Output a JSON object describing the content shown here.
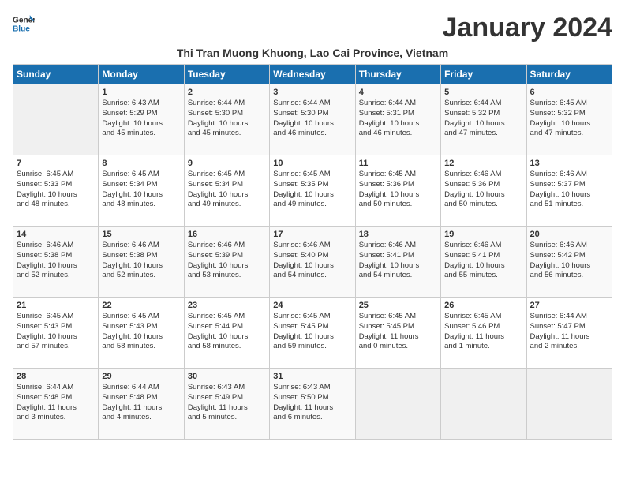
{
  "header": {
    "logo_general": "General",
    "logo_blue": "Blue",
    "month_year": "January 2024",
    "location": "Thi Tran Muong Khuong, Lao Cai Province, Vietnam"
  },
  "days_of_week": [
    "Sunday",
    "Monday",
    "Tuesday",
    "Wednesday",
    "Thursday",
    "Friday",
    "Saturday"
  ],
  "weeks": [
    [
      {
        "day": "",
        "info": ""
      },
      {
        "day": "1",
        "info": "Sunrise: 6:43 AM\nSunset: 5:29 PM\nDaylight: 10 hours\nand 45 minutes."
      },
      {
        "day": "2",
        "info": "Sunrise: 6:44 AM\nSunset: 5:30 PM\nDaylight: 10 hours\nand 45 minutes."
      },
      {
        "day": "3",
        "info": "Sunrise: 6:44 AM\nSunset: 5:30 PM\nDaylight: 10 hours\nand 46 minutes."
      },
      {
        "day": "4",
        "info": "Sunrise: 6:44 AM\nSunset: 5:31 PM\nDaylight: 10 hours\nand 46 minutes."
      },
      {
        "day": "5",
        "info": "Sunrise: 6:44 AM\nSunset: 5:32 PM\nDaylight: 10 hours\nand 47 minutes."
      },
      {
        "day": "6",
        "info": "Sunrise: 6:45 AM\nSunset: 5:32 PM\nDaylight: 10 hours\nand 47 minutes."
      }
    ],
    [
      {
        "day": "7",
        "info": "Sunrise: 6:45 AM\nSunset: 5:33 PM\nDaylight: 10 hours\nand 48 minutes."
      },
      {
        "day": "8",
        "info": "Sunrise: 6:45 AM\nSunset: 5:34 PM\nDaylight: 10 hours\nand 48 minutes."
      },
      {
        "day": "9",
        "info": "Sunrise: 6:45 AM\nSunset: 5:34 PM\nDaylight: 10 hours\nand 49 minutes."
      },
      {
        "day": "10",
        "info": "Sunrise: 6:45 AM\nSunset: 5:35 PM\nDaylight: 10 hours\nand 49 minutes."
      },
      {
        "day": "11",
        "info": "Sunrise: 6:45 AM\nSunset: 5:36 PM\nDaylight: 10 hours\nand 50 minutes."
      },
      {
        "day": "12",
        "info": "Sunrise: 6:46 AM\nSunset: 5:36 PM\nDaylight: 10 hours\nand 50 minutes."
      },
      {
        "day": "13",
        "info": "Sunrise: 6:46 AM\nSunset: 5:37 PM\nDaylight: 10 hours\nand 51 minutes."
      }
    ],
    [
      {
        "day": "14",
        "info": "Sunrise: 6:46 AM\nSunset: 5:38 PM\nDaylight: 10 hours\nand 52 minutes."
      },
      {
        "day": "15",
        "info": "Sunrise: 6:46 AM\nSunset: 5:38 PM\nDaylight: 10 hours\nand 52 minutes."
      },
      {
        "day": "16",
        "info": "Sunrise: 6:46 AM\nSunset: 5:39 PM\nDaylight: 10 hours\nand 53 minutes."
      },
      {
        "day": "17",
        "info": "Sunrise: 6:46 AM\nSunset: 5:40 PM\nDaylight: 10 hours\nand 54 minutes."
      },
      {
        "day": "18",
        "info": "Sunrise: 6:46 AM\nSunset: 5:41 PM\nDaylight: 10 hours\nand 54 minutes."
      },
      {
        "day": "19",
        "info": "Sunrise: 6:46 AM\nSunset: 5:41 PM\nDaylight: 10 hours\nand 55 minutes."
      },
      {
        "day": "20",
        "info": "Sunrise: 6:46 AM\nSunset: 5:42 PM\nDaylight: 10 hours\nand 56 minutes."
      }
    ],
    [
      {
        "day": "21",
        "info": "Sunrise: 6:45 AM\nSunset: 5:43 PM\nDaylight: 10 hours\nand 57 minutes."
      },
      {
        "day": "22",
        "info": "Sunrise: 6:45 AM\nSunset: 5:43 PM\nDaylight: 10 hours\nand 58 minutes."
      },
      {
        "day": "23",
        "info": "Sunrise: 6:45 AM\nSunset: 5:44 PM\nDaylight: 10 hours\nand 58 minutes."
      },
      {
        "day": "24",
        "info": "Sunrise: 6:45 AM\nSunset: 5:45 PM\nDaylight: 10 hours\nand 59 minutes."
      },
      {
        "day": "25",
        "info": "Sunrise: 6:45 AM\nSunset: 5:45 PM\nDaylight: 11 hours\nand 0 minutes."
      },
      {
        "day": "26",
        "info": "Sunrise: 6:45 AM\nSunset: 5:46 PM\nDaylight: 11 hours\nand 1 minute."
      },
      {
        "day": "27",
        "info": "Sunrise: 6:44 AM\nSunset: 5:47 PM\nDaylight: 11 hours\nand 2 minutes."
      }
    ],
    [
      {
        "day": "28",
        "info": "Sunrise: 6:44 AM\nSunset: 5:48 PM\nDaylight: 11 hours\nand 3 minutes."
      },
      {
        "day": "29",
        "info": "Sunrise: 6:44 AM\nSunset: 5:48 PM\nDaylight: 11 hours\nand 4 minutes."
      },
      {
        "day": "30",
        "info": "Sunrise: 6:43 AM\nSunset: 5:49 PM\nDaylight: 11 hours\nand 5 minutes."
      },
      {
        "day": "31",
        "info": "Sunrise: 6:43 AM\nSunset: 5:50 PM\nDaylight: 11 hours\nand 6 minutes."
      },
      {
        "day": "",
        "info": ""
      },
      {
        "day": "",
        "info": ""
      },
      {
        "day": "",
        "info": ""
      }
    ]
  ]
}
